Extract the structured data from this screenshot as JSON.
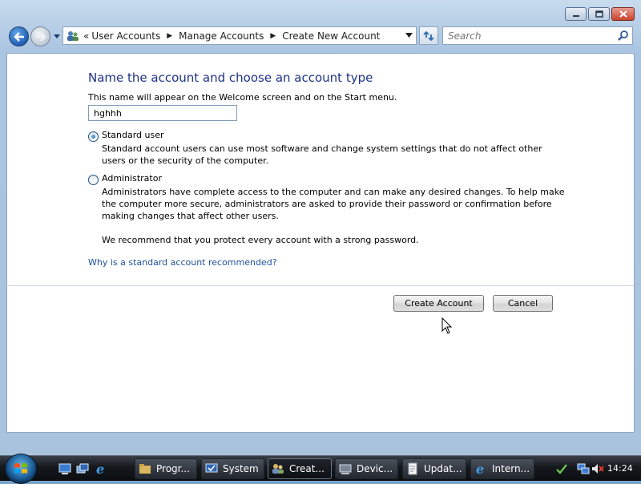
{
  "window": {
    "controls": {
      "minimize": "minimize",
      "maximize": "maximize",
      "close": "close"
    }
  },
  "nav": {
    "breadcrumb_prefix": "«",
    "breadcrumbs": [
      "User Accounts",
      "Manage Accounts",
      "Create New Account"
    ],
    "separator": "▶",
    "search_placeholder": "Search"
  },
  "content": {
    "heading": "Name the account and choose an account type",
    "subtitle": "This name will appear on the Welcome screen and on the Start menu.",
    "name_value": "hghhh",
    "options": [
      {
        "label": "Standard user",
        "selected": true,
        "description": "Standard account users can use most software and change system settings that do not affect other users or the security of the computer."
      },
      {
        "label": "Administrator",
        "selected": false,
        "description": "Administrators have complete access to the computer and can make any desired changes. To help make the computer more secure, administrators are asked to provide their password or confirmation before making changes that affect other users."
      }
    ],
    "recommendation": "We recommend that you protect every account with a strong password.",
    "help_link": "Why is a standard account recommended?",
    "create_button": "Create Account",
    "cancel_button": "Cancel"
  },
  "taskbar": {
    "buttons": [
      {
        "label": "Progr...",
        "icon": "folder-icon",
        "active": false
      },
      {
        "label": "System",
        "icon": "system-icon",
        "active": false
      },
      {
        "label": "Creat...",
        "icon": "user-accounts-icon",
        "active": true
      },
      {
        "label": "Devic...",
        "icon": "device-manager-icon",
        "active": false
      },
      {
        "label": "Updat...",
        "icon": "document-icon",
        "active": false
      },
      {
        "label": "Intern...",
        "icon": "ie-icon",
        "active": false
      }
    ],
    "clock": "14:24"
  },
  "colors": {
    "heading": "#1e3287",
    "link": "#1f4f9c",
    "taskbar": "#15181d"
  }
}
